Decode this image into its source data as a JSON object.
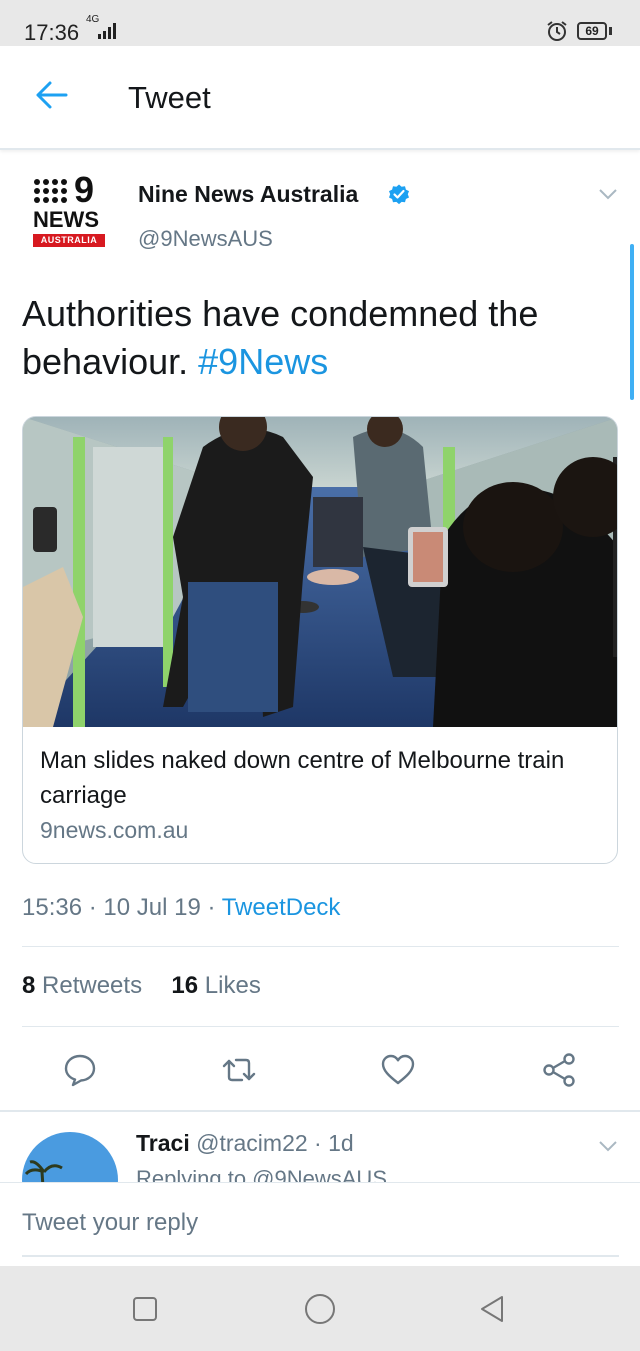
{
  "status_bar": {
    "time": "17:36",
    "network": "4G",
    "battery": "69"
  },
  "header": {
    "title": "Tweet"
  },
  "tweet": {
    "author_name": "Nine News Australia",
    "author_handle": "@9NewsAUS",
    "logo": {
      "wordmark": "NEWS",
      "numeral": "9",
      "region": "AUSTRALIA"
    },
    "text": "Authorities have condemned the behaviour.",
    "hashtag": "#9News",
    "card": {
      "title": "Man slides naked down centre of Melbourne train carriage",
      "domain": "9news.com.au"
    },
    "time": "15:36",
    "date": "10 Jul 19",
    "separator": "·",
    "source": "TweetDeck",
    "retweet_count": "8",
    "retweet_label": "Retweets",
    "like_count": "16",
    "like_label": "Likes"
  },
  "actions": {
    "reply_icon": "speech-bubble-icon",
    "retweet_icon": "retweet-icon",
    "like_icon": "heart-icon",
    "share_icon": "share-icon"
  },
  "reply": {
    "name": "Traci",
    "handle": "@tracim22",
    "age": "1d",
    "replying_to": "Replying to @9NewsAUS"
  },
  "composer": {
    "placeholder": "Tweet your reply"
  },
  "colors": {
    "accent": "#1da1f2",
    "link": "#1b95e0",
    "secondary_text": "#657786",
    "divider": "#e1e8ed"
  }
}
